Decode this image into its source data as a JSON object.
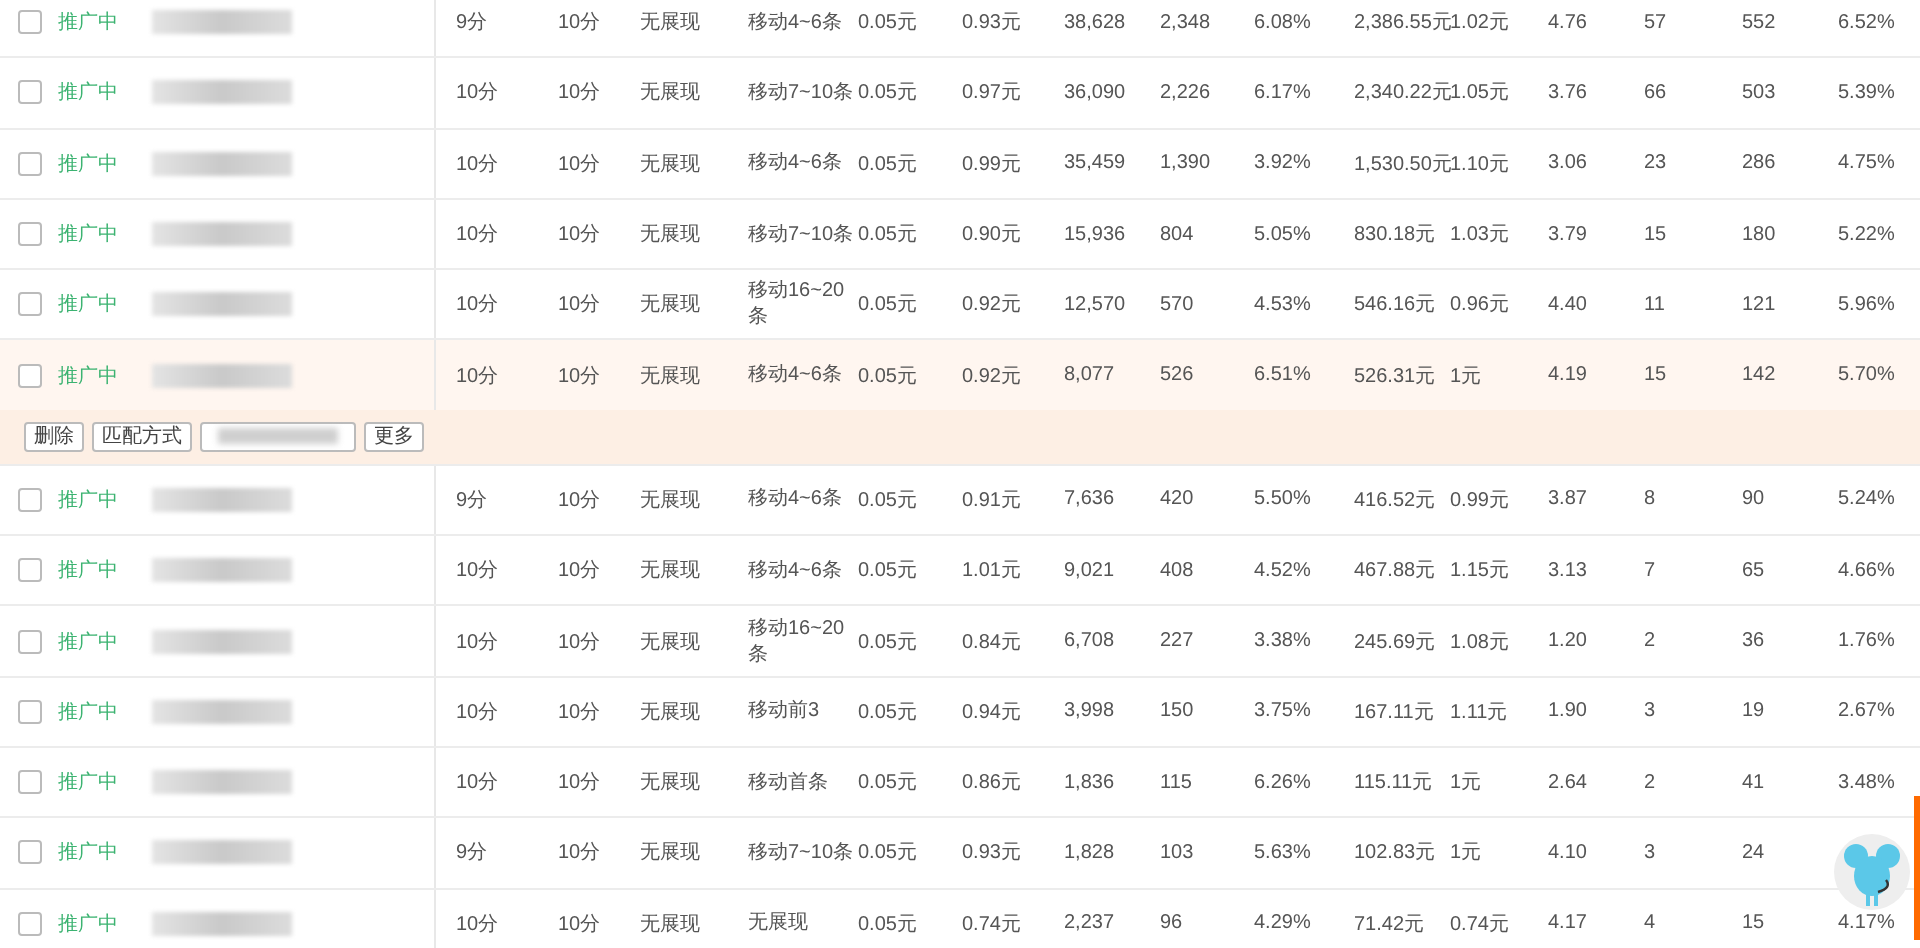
{
  "rows": [
    {
      "checked": false,
      "status": "推广中",
      "keyword_hidden": true,
      "highlighted": false,
      "c1": "9分",
      "c2": "10分",
      "c3": "无展现",
      "c4": "移动4~6条",
      "c5": "0.05元",
      "c6": "0.93元",
      "c7": "38,628",
      "c8": "2,348",
      "c9": "6.08%",
      "c10": "2,386.55元",
      "c11": "1.02元",
      "c12": "4.76",
      "c13": "57",
      "c14": "552",
      "c15": "6.52%"
    },
    {
      "checked": false,
      "status": "推广中",
      "keyword_hidden": true,
      "highlighted": false,
      "c1": "10分",
      "c2": "10分",
      "c3": "无展现",
      "c4": "移动7~10条",
      "c5": "0.05元",
      "c6": "0.97元",
      "c7": "36,090",
      "c8": "2,226",
      "c9": "6.17%",
      "c10": "2,340.22元",
      "c11": "1.05元",
      "c12": "3.76",
      "c13": "66",
      "c14": "503",
      "c15": "5.39%"
    },
    {
      "checked": false,
      "status": "推广中",
      "keyword_hidden": true,
      "highlighted": false,
      "c1": "10分",
      "c2": "10分",
      "c3": "无展现",
      "c4": "移动4~6条",
      "c5": "0.05元",
      "c6": "0.99元",
      "c7": "35,459",
      "c8": "1,390",
      "c9": "3.92%",
      "c10": "1,530.50元",
      "c11": "1.10元",
      "c12": "3.06",
      "c13": "23",
      "c14": "286",
      "c15": "4.75%"
    },
    {
      "checked": false,
      "status": "推广中",
      "keyword_hidden": true,
      "highlighted": false,
      "c1": "10分",
      "c2": "10分",
      "c3": "无展现",
      "c4": "移动7~10条",
      "c5": "0.05元",
      "c6": "0.90元",
      "c7": "15,936",
      "c8": "804",
      "c9": "5.05%",
      "c10": "830.18元",
      "c11": "1.03元",
      "c12": "3.79",
      "c13": "15",
      "c14": "180",
      "c15": "5.22%"
    },
    {
      "checked": false,
      "status": "推广中",
      "keyword_hidden": true,
      "highlighted": false,
      "c1": "10分",
      "c2": "10分",
      "c3": "无展现",
      "c4": "移动16~20条",
      "c5": "0.05元",
      "c6": "0.92元",
      "c7": "12,570",
      "c8": "570",
      "c9": "4.53%",
      "c10": "546.16元",
      "c11": "0.96元",
      "c12": "4.40",
      "c13": "11",
      "c14": "121",
      "c15": "5.96%"
    },
    {
      "checked": false,
      "status": "推广中",
      "keyword_hidden": true,
      "highlighted": true,
      "c1": "10分",
      "c2": "10分",
      "c3": "无展现",
      "c4": "移动4~6条",
      "c5": "0.05元",
      "c6": "0.92元",
      "c7": "8,077",
      "c8": "526",
      "c9": "6.51%",
      "c10": "526.31元",
      "c11": "1元",
      "c12": "4.19",
      "c13": "15",
      "c14": "142",
      "c15": "5.70%",
      "actions": [
        {
          "kind": "text",
          "label": "删除"
        },
        {
          "kind": "text",
          "label": "匹配方式"
        },
        {
          "kind": "hidden"
        },
        {
          "kind": "text",
          "label": "更多"
        }
      ]
    },
    {
      "checked": false,
      "status": "推广中",
      "keyword_hidden": true,
      "highlighted": false,
      "c1": "9分",
      "c2": "10分",
      "c3": "无展现",
      "c4": "移动4~6条",
      "c5": "0.05元",
      "c6": "0.91元",
      "c7": "7,636",
      "c8": "420",
      "c9": "5.50%",
      "c10": "416.52元",
      "c11": "0.99元",
      "c12": "3.87",
      "c13": "8",
      "c14": "90",
      "c15": "5.24%"
    },
    {
      "checked": false,
      "status": "推广中",
      "keyword_hidden": true,
      "highlighted": false,
      "c1": "10分",
      "c2": "10分",
      "c3": "无展现",
      "c4": "移动4~6条",
      "c5": "0.05元",
      "c6": "1.01元",
      "c7": "9,021",
      "c8": "408",
      "c9": "4.52%",
      "c10": "467.88元",
      "c11": "1.15元",
      "c12": "3.13",
      "c13": "7",
      "c14": "65",
      "c15": "4.66%"
    },
    {
      "checked": false,
      "status": "推广中",
      "keyword_hidden": true,
      "highlighted": false,
      "c1": "10分",
      "c2": "10分",
      "c3": "无展现",
      "c4": "移动16~20条",
      "c5": "0.05元",
      "c6": "0.84元",
      "c7": "6,708",
      "c8": "227",
      "c9": "3.38%",
      "c10": "245.69元",
      "c11": "1.08元",
      "c12": "1.20",
      "c13": "2",
      "c14": "36",
      "c15": "1.76%"
    },
    {
      "checked": false,
      "status": "推广中",
      "keyword_hidden": true,
      "highlighted": false,
      "c1": "10分",
      "c2": "10分",
      "c3": "无展现",
      "c4": "移动前3",
      "c5": "0.05元",
      "c6": "0.94元",
      "c7": "3,998",
      "c8": "150",
      "c9": "3.75%",
      "c10": "167.11元",
      "c11": "1.11元",
      "c12": "1.90",
      "c13": "3",
      "c14": "19",
      "c15": "2.67%"
    },
    {
      "checked": false,
      "status": "推广中",
      "keyword_hidden": true,
      "highlighted": false,
      "c1": "10分",
      "c2": "10分",
      "c3": "无展现",
      "c4": "移动首条",
      "c5": "0.05元",
      "c6": "0.86元",
      "c7": "1,836",
      "c8": "115",
      "c9": "6.26%",
      "c10": "115.11元",
      "c11": "1元",
      "c12": "2.64",
      "c13": "2",
      "c14": "41",
      "c15": "3.48%"
    },
    {
      "checked": false,
      "status": "推广中",
      "keyword_hidden": true,
      "highlighted": false,
      "c1": "9分",
      "c2": "10分",
      "c3": "无展现",
      "c4": "移动7~10条",
      "c5": "0.05元",
      "c6": "0.93元",
      "c7": "1,828",
      "c8": "103",
      "c9": "5.63%",
      "c10": "102.83元",
      "c11": "1元",
      "c12": "4.10",
      "c13": "3",
      "c14": "24"
    },
    {
      "checked": false,
      "status": "推广中",
      "keyword_hidden": true,
      "highlighted": false,
      "c1": "10分",
      "c2": "10分",
      "c3": "无展现",
      "c4": "无展现",
      "c5": "0.05元",
      "c6": "0.74元",
      "c7": "2,237",
      "c8": "96",
      "c9": "4.29%",
      "c10": "71.42元",
      "c11": "0.74元",
      "c12": "4.17",
      "c13": "4",
      "c14": "15",
      "c15": "4.17%"
    }
  ]
}
